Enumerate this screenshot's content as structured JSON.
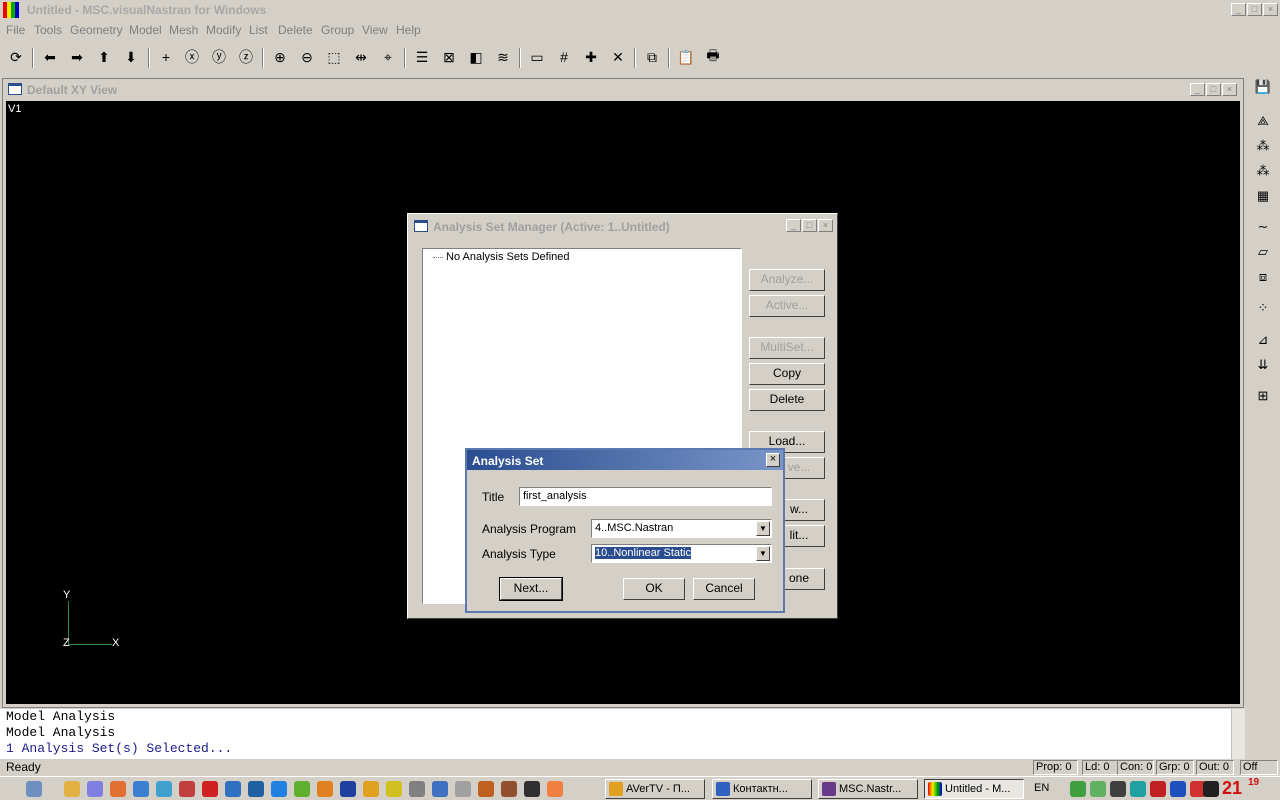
{
  "app": {
    "title": "Untitled - MSC.visualNastran for Windows"
  },
  "menu": [
    "File",
    "Tools",
    "Geometry",
    "Model",
    "Mesh",
    "Modify",
    "List",
    "Delete",
    "Group",
    "View",
    "Help"
  ],
  "toolbar_icons": [
    "rotate-icon",
    "arrow-left-icon",
    "arrow-right-icon",
    "arrow-up-icon",
    "arrow-down-icon",
    "plus-icon",
    "rotate-x-icon",
    "rotate-y-icon",
    "rotate-z-icon",
    "zoom-in-icon",
    "zoom-out-icon",
    "select-box-icon",
    "pan-icon",
    "center-icon",
    "list-icon",
    "box-x-icon",
    "cube-icon",
    "layers-icon",
    "window-icon",
    "grid-icon",
    "cross-icon",
    "delete-icon",
    "fit-icon",
    "clipboard-icon",
    "print-icon"
  ],
  "view": {
    "title": "Default XY View",
    "label": "V1",
    "axis_y": "Y",
    "axis_z": "Z",
    "axis_x": "X"
  },
  "asm": {
    "title": "Analysis Set Manager (Active: 1..Untitled)",
    "tree_item": "No Analysis Sets Defined",
    "buttons": {
      "analyze": "Analyze...",
      "active": "Active...",
      "multiset": "MultiSet...",
      "copy": "Copy",
      "delete": "Delete",
      "load": "Load...",
      "save": "ve...",
      "new": "w...",
      "edit": "lit...",
      "done": "one"
    }
  },
  "analysis_set": {
    "title": "Analysis Set",
    "title_label": "Title",
    "title_value": "first_analysis",
    "program_label": "Analysis Program",
    "program_value": "4..MSC.Nastran",
    "type_label": "Analysis Type",
    "type_value": "10..Nonlinear Static",
    "next": "Next...",
    "ok": "OK",
    "cancel": "Cancel"
  },
  "messages": [
    "Model Analysis",
    "Model Analysis",
    "1 Analysis Set(s) Selected..."
  ],
  "status": {
    "ready": "Ready",
    "prop": "Prop: 0",
    "ld": "Ld: 0",
    "con": "Con: 0",
    "grp": "Grp: 0",
    "out": "Out: 0",
    "off": "Off"
  },
  "taskbar": {
    "buttons": [
      "AVerTV - П...",
      "Контактн...",
      "MSC.Nastr...",
      "Untitled - M..."
    ],
    "lang": "EN",
    "clock": "21",
    "clock_min": "19"
  },
  "colors": {
    "view_bg": "#000000",
    "dialog_title": "#2a4d8f",
    "axis": "#2e8b57"
  }
}
